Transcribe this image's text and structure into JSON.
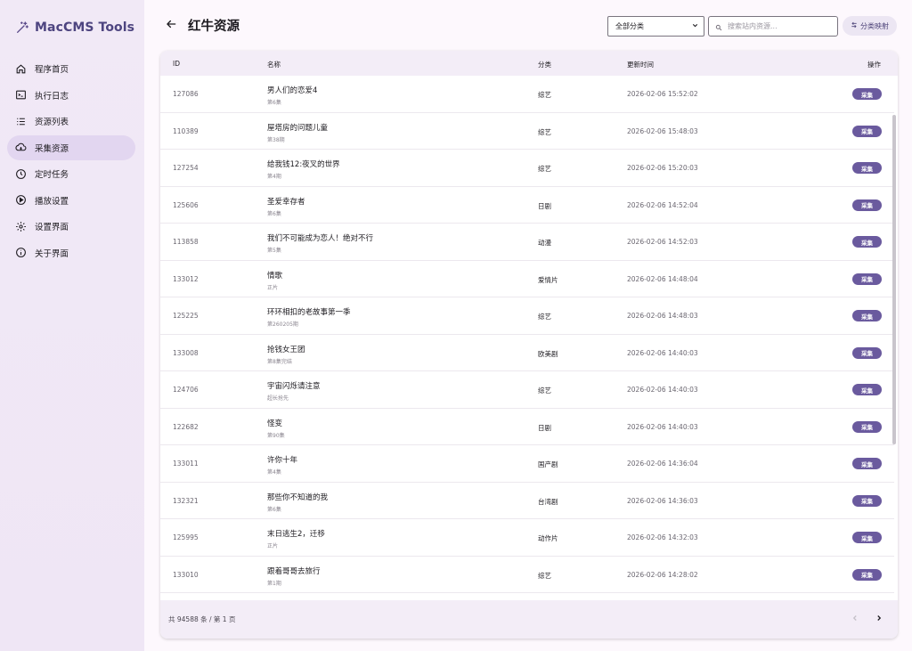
{
  "app": {
    "title": "MacCMS Tools"
  },
  "sidebar": {
    "items": [
      {
        "label": "程序首页",
        "icon": "home-icon"
      },
      {
        "label": "执行日志",
        "icon": "terminal-icon"
      },
      {
        "label": "资源列表",
        "icon": "list-icon"
      },
      {
        "label": "采集资源",
        "icon": "cloud-download-icon",
        "active": true
      },
      {
        "label": "定时任务",
        "icon": "clock-icon"
      },
      {
        "label": "播放设置",
        "icon": "play-circle-icon"
      },
      {
        "label": "设置界面",
        "icon": "gear-icon"
      },
      {
        "label": "关于界面",
        "icon": "info-icon"
      }
    ]
  },
  "header": {
    "title": "红牛资源",
    "category_selected": "全部分类",
    "search_placeholder": "搜索站内资源...",
    "map_button_label": "分类映射"
  },
  "table": {
    "columns": {
      "id": "ID",
      "name": "名称",
      "category": "分类",
      "updated": "更新时间",
      "action": "操作"
    },
    "action_label": "采集",
    "rows": [
      {
        "id": "127086",
        "name": "男人们的恋爱4",
        "sub": "第6集",
        "category": "综艺",
        "updated": "2026-02-06 15:52:02"
      },
      {
        "id": "110389",
        "name": "屋塔房的问题儿童",
        "sub": "第38期",
        "category": "综艺",
        "updated": "2026-02-06 15:48:03"
      },
      {
        "id": "127254",
        "name": "给我钱12:夜叉的世界",
        "sub": "第4期",
        "category": "综艺",
        "updated": "2026-02-06 15:20:03"
      },
      {
        "id": "125606",
        "name": "圣爱幸存者",
        "sub": "第6集",
        "category": "日剧",
        "updated": "2026-02-06 14:52:04"
      },
      {
        "id": "113858",
        "name": "我们不可能成为恋人！绝对不行",
        "sub": "第5集",
        "category": "动漫",
        "updated": "2026-02-06 14:52:03"
      },
      {
        "id": "133012",
        "name": "情歌",
        "sub": "正片",
        "category": "爱情片",
        "updated": "2026-02-06 14:48:04"
      },
      {
        "id": "125225",
        "name": "环环相扣的老故事第一季",
        "sub": "第260205期",
        "category": "综艺",
        "updated": "2026-02-06 14:48:03"
      },
      {
        "id": "133008",
        "name": "抢钱女王团",
        "sub": "第8集完结",
        "category": "欧美剧",
        "updated": "2026-02-06 14:40:03"
      },
      {
        "id": "124706",
        "name": "宇宙闪烁请注意",
        "sub": "超长抢先",
        "category": "综艺",
        "updated": "2026-02-06 14:40:03"
      },
      {
        "id": "122682",
        "name": "怪变",
        "sub": "第90集",
        "category": "日剧",
        "updated": "2026-02-06 14:40:03"
      },
      {
        "id": "133011",
        "name": "许你十年",
        "sub": "第4集",
        "category": "国产剧",
        "updated": "2026-02-06 14:36:04"
      },
      {
        "id": "132321",
        "name": "那些你不知道的我",
        "sub": "第6集",
        "category": "台湾剧",
        "updated": "2026-02-06 14:36:03"
      },
      {
        "id": "125995",
        "name": "末日逃生2，迁移",
        "sub": "正片",
        "category": "动作片",
        "updated": "2026-02-06 14:32:03"
      },
      {
        "id": "133010",
        "name": "跟着哥哥去旅行",
        "sub": "第1期",
        "category": "综艺",
        "updated": "2026-02-06 14:28:02"
      }
    ]
  },
  "footer": {
    "info": "共 94588 条 / 第 1 页"
  },
  "colors": {
    "accent": "#6a5a9e",
    "active_nav": "#e2d6f0"
  }
}
